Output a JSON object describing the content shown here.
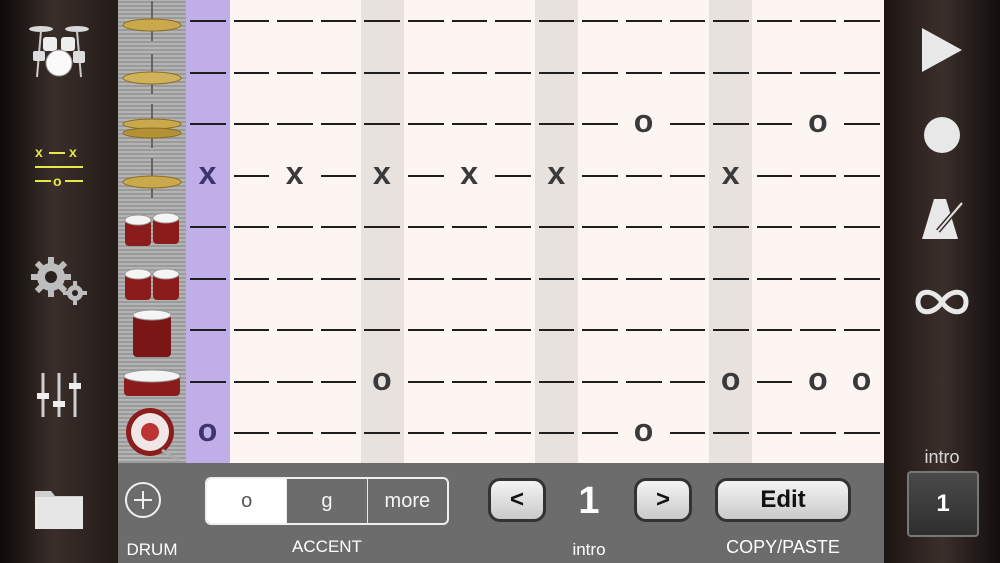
{
  "app": {
    "name": "Drum notation editor"
  },
  "left_toolbar": {
    "items": [
      {
        "icon": "drum-kit-icon"
      },
      {
        "icon": "notation-icon"
      },
      {
        "icon": "gears-icon"
      },
      {
        "icon": "mixer-sliders-icon"
      },
      {
        "icon": "folder-icon"
      }
    ]
  },
  "instruments": [
    "crash-cymbal",
    "splash-cymbal",
    "hi-hat",
    "ride-cymbal",
    "high-toms",
    "mid-toms",
    "floor-tom",
    "snare-drum",
    "bass-drum"
  ],
  "grid": {
    "current_step": 0,
    "rows": [
      {
        "notes": [
          "",
          "",
          "",
          "",
          "",
          "",
          "",
          "",
          "",
          "",
          "",
          "",
          "",
          "",
          "",
          ""
        ]
      },
      {
        "notes": [
          "",
          "",
          "",
          "",
          "",
          "",
          "",
          "",
          "",
          "",
          "",
          "",
          "",
          "",
          "",
          ""
        ]
      },
      {
        "notes": [
          "",
          "",
          "",
          "",
          "",
          "",
          "",
          "",
          "",
          "",
          "o",
          "",
          "",
          "",
          "o",
          ""
        ]
      },
      {
        "notes": [
          "x",
          "",
          "x",
          "",
          "x",
          "",
          "x",
          "",
          "x",
          "",
          "",
          "",
          "x",
          "",
          "",
          ""
        ]
      },
      {
        "notes": [
          "",
          "",
          "",
          "",
          "",
          "",
          "",
          "",
          "",
          "",
          "",
          "",
          "",
          "",
          "",
          ""
        ]
      },
      {
        "notes": [
          "",
          "",
          "",
          "",
          "",
          "",
          "",
          "",
          "",
          "",
          "",
          "",
          "",
          "",
          "",
          ""
        ]
      },
      {
        "notes": [
          "",
          "",
          "",
          "",
          "",
          "",
          "",
          "",
          "",
          "",
          "",
          "",
          "",
          "",
          "",
          ""
        ]
      },
      {
        "notes": [
          "",
          "",
          "",
          "",
          "o",
          "",
          "",
          "",
          "",
          "",
          "",
          "",
          "o",
          "",
          "o",
          "o"
        ]
      },
      {
        "notes": [
          "o",
          "",
          "",
          "",
          "",
          "",
          "",
          "",
          "",
          "",
          "o",
          "",
          "",
          "",
          "",
          ""
        ]
      }
    ]
  },
  "bottom": {
    "drum_label": "DRUM",
    "accent_options": [
      "o",
      "g",
      "more"
    ],
    "accent_selected": "o",
    "accent_label": "ACCENT",
    "prev_label": "<",
    "next_label": ">",
    "measure_number": "1",
    "section_label": "intro",
    "edit_label": "Edit",
    "copy_paste_label": "COPY/PASTE"
  },
  "right_toolbar": {
    "items": [
      {
        "icon": "play-icon"
      },
      {
        "icon": "record-icon"
      },
      {
        "icon": "metronome-icon"
      },
      {
        "icon": "loop-icon"
      }
    ],
    "section_label": "intro",
    "section_number": "1"
  },
  "colors": {
    "current_column": "#bfaee8",
    "beat_column": "#e8e2de",
    "grid_background": "#fdf5f1",
    "toolbar_background": "#6c6c6c"
  }
}
